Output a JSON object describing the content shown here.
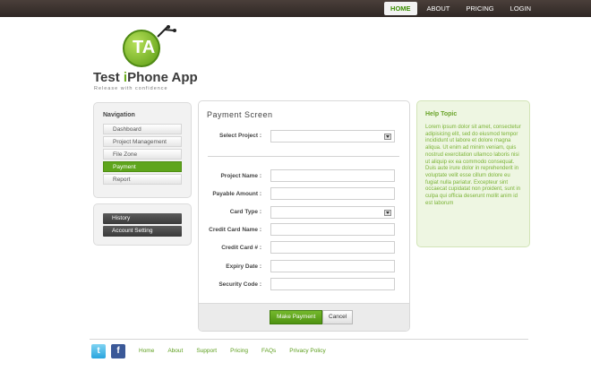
{
  "topnav": [
    "HOME",
    "ABOUT",
    "PRICING",
    "LOGIN"
  ],
  "logo": {
    "mark": "TA",
    "title_pre": "Test ",
    "title_hl": "i",
    "title_post": "Phone App",
    "tagline": "Release with confidence"
  },
  "navigation": {
    "title": "Navigation",
    "items": [
      "Dashboard",
      "Project Management",
      "File Zone",
      "Payment",
      "Report"
    ],
    "active": "Payment"
  },
  "account": [
    "History",
    "Account Setting"
  ],
  "form": {
    "title": "Payment Screen",
    "select_project_label": "Select Project :",
    "project_name_label": "Project Name :",
    "payable_amount_label": "Payable Amount :",
    "card_type_label": "Card Type :",
    "credit_card_name_label": "Credit Card Name :",
    "credit_card_no_label": "Credit Card # :",
    "expiry_label": "Expiry Date :",
    "security_label": "Security Code :",
    "submit": "Make Payment",
    "cancel": "Cancel"
  },
  "help": {
    "title": "Help Topic",
    "text": "Lorem ipsum dolor sit amet, consectetur adipisicing elit, sed do eiusmod tempor incididunt ut labore et dolore magna aliqua. Ut enim ad minim veniam, quis nostrud exercitation ullamco laboris nisi ut aliquip ex ea commodo consequat. Duis aute irure dolor in reprehenderit in voluptate velit esse cillum dolore eu fugiat nulla pariatur. Excepteur sint occaecat cupidatat non proident, sunt in culpa qui officia deserunt mollit anim id est laborum"
  },
  "footer": [
    "Home",
    "About",
    "Support",
    "Pricing",
    "FAQs",
    "Privacy Policy"
  ],
  "colors": {
    "accent": "#5ea51c",
    "topbar": "#3a302c",
    "help_bg": "#eef6e2"
  }
}
